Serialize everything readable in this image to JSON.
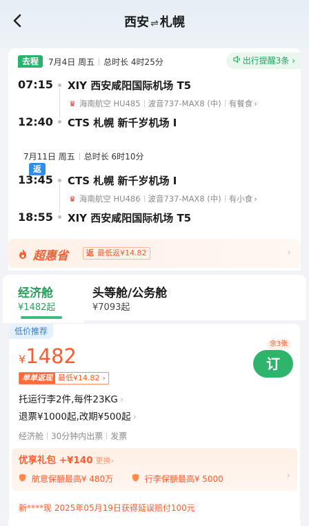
{
  "header": {
    "back_icon": "chevron-left-icon",
    "origin": "西安",
    "swap_glyph": "⇌",
    "destination": "札幌"
  },
  "outbound": {
    "tag": "去程",
    "date": "7月4日 周五",
    "duration": "总时长 4时25分",
    "reminder": "出行提醒3条",
    "dep_time": "07:15",
    "dep_airport": "XIY 西安咸阳国际机场 T5",
    "airline": "海南航空 HU485",
    "aircraft": "波音737-MAX8 (中)",
    "meal": "有餐食",
    "arr_time": "12:40",
    "arr_airport": "CTS 札幌 新千岁机场 I"
  },
  "inbound": {
    "tag": "返程",
    "date": "7月11日 周五",
    "duration": "总时长 6时10分",
    "dep_time": "13:45",
    "dep_airport": "CTS 札幌 新千岁机场 I",
    "airline": "海南航空 HU486",
    "aircraft": "波音737-MAX8 (中)",
    "meal": "有小食",
    "arr_time": "18:55",
    "arr_airport": "XIY 西安咸阳国际机场 T5"
  },
  "promo": {
    "brand": "超惠省",
    "rebate_tag": "返",
    "rebate_text": "最低返¥14.82"
  },
  "cabin_tabs": [
    {
      "name": "经济舱",
      "price": "¥1482起",
      "selected": true
    },
    {
      "name": "头等舱/公务舱",
      "price": "¥7093起",
      "selected": false
    }
  ],
  "fare": {
    "tag": "低价推荐",
    "currency": "¥",
    "price": "1482",
    "remaining": "余3张",
    "book_label": "订",
    "single_tag": "单单返现",
    "single_text": "最低¥14.82",
    "baggage": "托运行李2件,每件23KG",
    "refund": "退票¥1000起,改期¥500起",
    "meta": [
      "经济舱",
      "30分钟内出票",
      "发票"
    ],
    "gift_title": "优享礼包 +¥140",
    "gift_change": "更换",
    "insurance1": "航意保额最高¥ 480万",
    "insurance2": "行李保额最高¥ 5000",
    "notice": "新****现 2025年05月19日获得延误赔付100元"
  },
  "colors": {
    "accent_green": "#27a05e",
    "accent_orange": "#ff5b2e",
    "return_blue": "#2e8ee8"
  }
}
